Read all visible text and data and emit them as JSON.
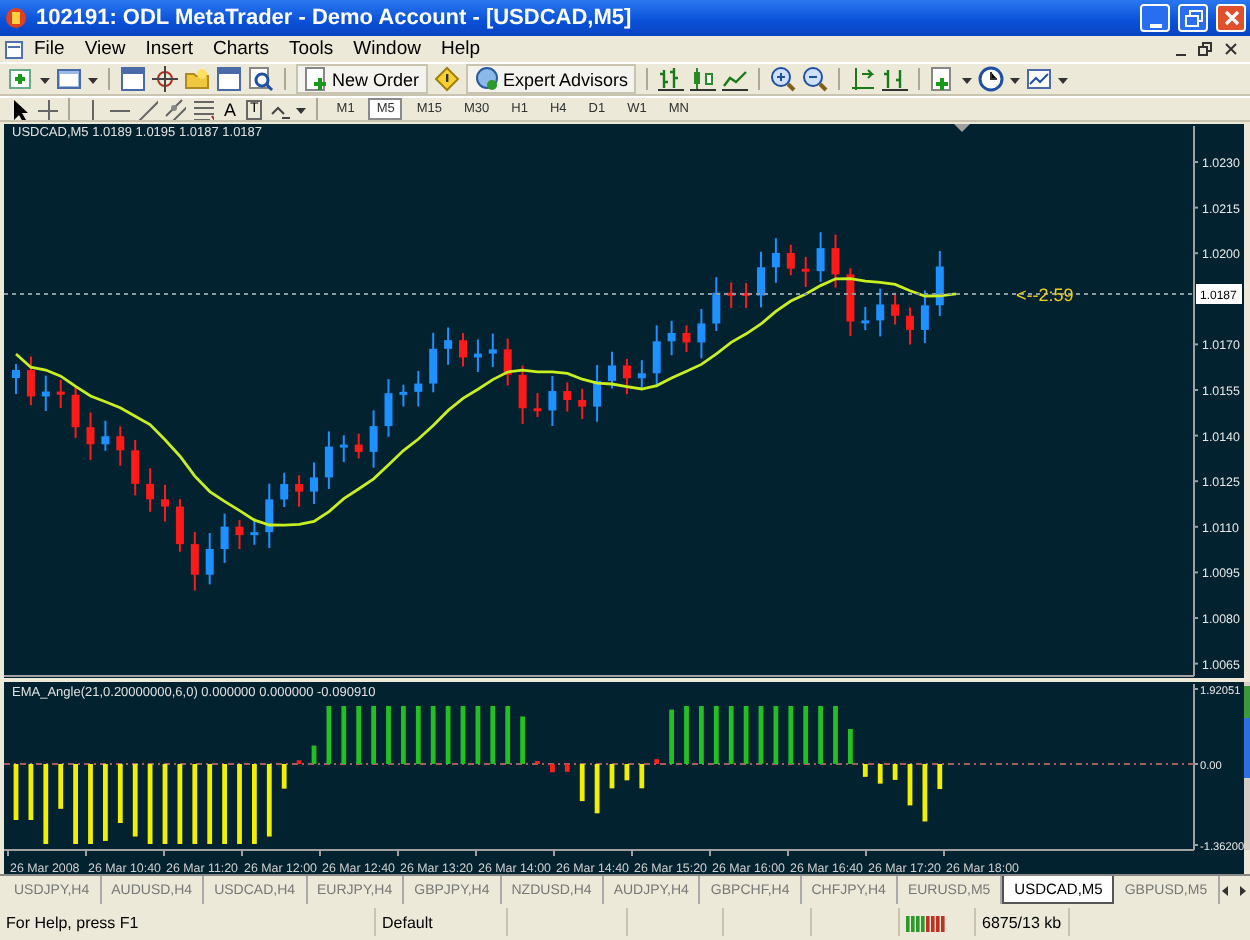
{
  "window": {
    "title": "102191: ODL MetaTrader - Demo Account - [USDCAD,M5]"
  },
  "menu": [
    "File",
    "View",
    "Insert",
    "Charts",
    "Tools",
    "Window",
    "Help"
  ],
  "toolbar": {
    "new_order": "New Order",
    "expert_advisors": "Expert Advisors"
  },
  "drawing_tools": {
    "text_tool": "A",
    "label_tool": "T"
  },
  "timeframes": [
    {
      "label": "M1",
      "selected": false
    },
    {
      "label": "M5",
      "selected": true
    },
    {
      "label": "M15",
      "selected": false
    },
    {
      "label": "M30",
      "selected": false
    },
    {
      "label": "H1",
      "selected": false
    },
    {
      "label": "H4",
      "selected": false
    },
    {
      "label": "D1",
      "selected": false
    },
    {
      "label": "W1",
      "selected": false
    },
    {
      "label": "MN",
      "selected": false
    }
  ],
  "chart": {
    "info": "USDCAD,M5  1.0189 1.0195 1.0187 1.0187",
    "price_axis": [
      "1.0230",
      "1.0215",
      "1.0200",
      "1.0170",
      "1.0155",
      "1.0140",
      "1.0125",
      "1.0110",
      "1.0095",
      "1.0080",
      "1.0065"
    ],
    "current_price": "1.0187",
    "countdown": "<--2:59",
    "indicator": {
      "info": "EMA_Angle(21,0.20000000,6,0) 0.000000 0.000000 -0.090910",
      "axis": [
        "1.92051",
        "0.00",
        "-1.36200"
      ]
    },
    "time_axis": [
      "26 Mar 2008",
      "26 Mar 10:40",
      "26 Mar 11:20",
      "26 Mar 12:00",
      "26 Mar 12:40",
      "26 Mar 13:20",
      "26 Mar 14:00",
      "26 Mar 14:40",
      "26 Mar 15:20",
      "26 Mar 16:00",
      "26 Mar 16:40",
      "26 Mar 17:20",
      "26 Mar 18:00"
    ]
  },
  "tabs": [
    {
      "label": "USDJPY,H4",
      "selected": false
    },
    {
      "label": "AUDUSD,H4",
      "selected": false
    },
    {
      "label": "USDCAD,H4",
      "selected": false
    },
    {
      "label": "EURJPY,H4",
      "selected": false
    },
    {
      "label": "GBPJPY,H4",
      "selected": false
    },
    {
      "label": "NZDUSD,H4",
      "selected": false
    },
    {
      "label": "AUDJPY,H4",
      "selected": false
    },
    {
      "label": "GBPCHF,H4",
      "selected": false
    },
    {
      "label": "CHFJPY,H4",
      "selected": false
    },
    {
      "label": "EURUSD,M5",
      "selected": false
    },
    {
      "label": "USDCAD,M5",
      "selected": true
    },
    {
      "label": "GBPUSD,M5",
      "selected": false
    }
  ],
  "status_bar": {
    "help": "For Help, press F1",
    "profile": "Default",
    "traffic": "6875/13 kb"
  }
}
